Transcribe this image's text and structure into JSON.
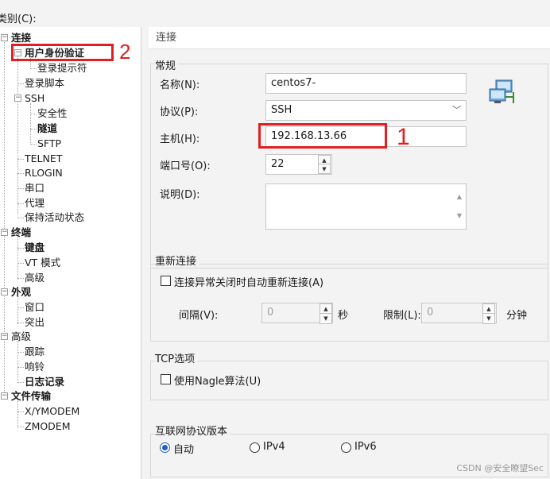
{
  "category_label": "类别(C):",
  "tree": [
    {
      "key": "conn",
      "label": "连接",
      "bold": true,
      "expander": "−"
    },
    {
      "key": "auth",
      "label": "用户身份验证",
      "bold": true,
      "expander": "−"
    },
    {
      "key": "login_prompt",
      "label": "登录提示符",
      "bold": false
    },
    {
      "key": "login_script",
      "label": "登录脚本",
      "bold": false
    },
    {
      "key": "ssh",
      "label": "SSH",
      "bold": false,
      "expander": "−"
    },
    {
      "key": "security",
      "label": "安全性",
      "bold": false
    },
    {
      "key": "tunnel",
      "label": "隧道",
      "bold": true
    },
    {
      "key": "sftp",
      "label": "SFTP",
      "bold": false
    },
    {
      "key": "telnet",
      "label": "TELNET",
      "bold": false
    },
    {
      "key": "rlogin",
      "label": "RLOGIN",
      "bold": false
    },
    {
      "key": "serial",
      "label": "串口",
      "bold": false
    },
    {
      "key": "proxy",
      "label": "代理",
      "bold": false
    },
    {
      "key": "keepalive",
      "label": "保持活动状态",
      "bold": false
    },
    {
      "key": "terminal",
      "label": "终端",
      "bold": true,
      "expander": "−"
    },
    {
      "key": "keyboard",
      "label": "键盘",
      "bold": true
    },
    {
      "key": "vt_mode",
      "label": "VT 模式",
      "bold": false
    },
    {
      "key": "term_advanced",
      "label": "高级",
      "bold": false
    },
    {
      "key": "appearance",
      "label": "外观",
      "bold": true,
      "expander": "−"
    },
    {
      "key": "window",
      "label": "窗口",
      "bold": false
    },
    {
      "key": "highlight",
      "label": "突出",
      "bold": false
    },
    {
      "key": "advanced",
      "label": "高级",
      "bold": false,
      "expander": "−"
    },
    {
      "key": "trace",
      "label": "跟踪",
      "bold": false
    },
    {
      "key": "bell",
      "label": "响铃",
      "bold": false
    },
    {
      "key": "logging",
      "label": "日志记录",
      "bold": true
    },
    {
      "key": "filetransfer",
      "label": "文件传输",
      "bold": true,
      "expander": "−"
    },
    {
      "key": "xymodem",
      "label": "X/YMODEM",
      "bold": false
    },
    {
      "key": "zmodem",
      "label": "ZMODEM",
      "bold": false
    }
  ],
  "annotations": {
    "one": "1",
    "two": "2"
  },
  "panel": {
    "header": "连接",
    "general": {
      "title": "常规",
      "name_label": "名称(N):",
      "name_value": "centos7-",
      "protocol_label": "协议(P):",
      "protocol_value": "SSH",
      "host_label": "主机(H):",
      "host_value": "192.168.13.66",
      "port_label": "端口号(O):",
      "port_value": "22",
      "desc_label": "说明(D):"
    },
    "reconnect": {
      "title": "重新连接",
      "auto_label": "连接异常关闭时自动重新连接(A)",
      "interval_label": "间隔(V):",
      "interval_value": "0",
      "interval_unit": "秒",
      "limit_label": "限制(L):",
      "limit_value": "0",
      "limit_unit": "分钟"
    },
    "tcp": {
      "title": "TCP选项",
      "nagle_label": "使用Nagle算法(U)"
    },
    "ip": {
      "title": "互联网协议版本",
      "auto": "自动",
      "ipv4": "IPv4",
      "ipv6": "IPv6",
      "selected": "auto"
    }
  },
  "watermark": "CSDN @安全瞭望Sec",
  "colors": {
    "annotation_red": "#e02020",
    "radio_selected": "#1f5fbf"
  }
}
